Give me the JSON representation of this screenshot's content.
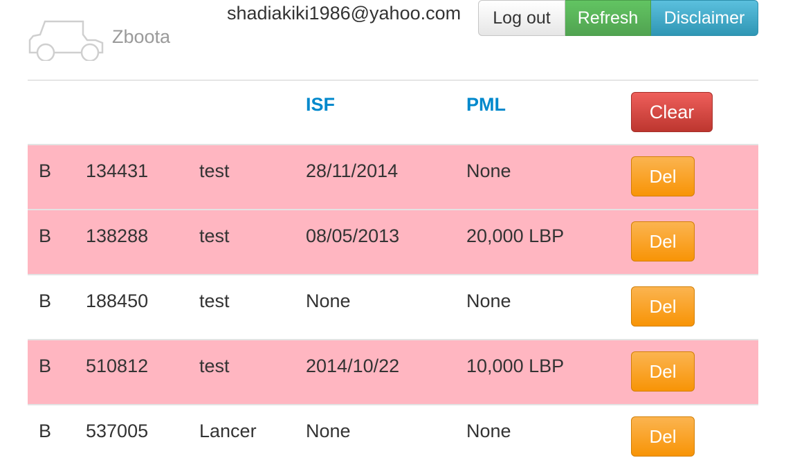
{
  "header": {
    "brand": "Zboota",
    "email": "shadiakiki1986@yahoo.com",
    "logout_label": "Log out",
    "refresh_label": "Refresh",
    "disclaimer_label": "Disclaimer"
  },
  "table": {
    "columns": [
      "",
      "",
      "",
      "ISF",
      "PML",
      ""
    ],
    "clear_label": "Clear",
    "del_label": "Del",
    "rows": [
      {
        "code": "B",
        "number": "134431",
        "name": "test",
        "isf": "28/11/2014",
        "pml": "None",
        "highlight": true
      },
      {
        "code": "B",
        "number": "138288",
        "name": "test",
        "isf": "08/05/2013",
        "pml": "20,000 LBP",
        "highlight": true
      },
      {
        "code": "B",
        "number": "188450",
        "name": "test",
        "isf": "None",
        "pml": "None",
        "highlight": false
      },
      {
        "code": "B",
        "number": "510812",
        "name": "test",
        "isf": "2014/10/22",
        "pml": "10,000 LBP",
        "highlight": true
      },
      {
        "code": "B",
        "number": "537005",
        "name": "Lancer",
        "isf": "None",
        "pml": "None",
        "highlight": false
      }
    ]
  },
  "colors": {
    "highlight_row": "#ffb6c1",
    "header_link": "#0088cc",
    "refresh": "#5bb75b",
    "disclaimer": "#49afcd",
    "clear": "#da4f49",
    "del": "#faa732"
  }
}
